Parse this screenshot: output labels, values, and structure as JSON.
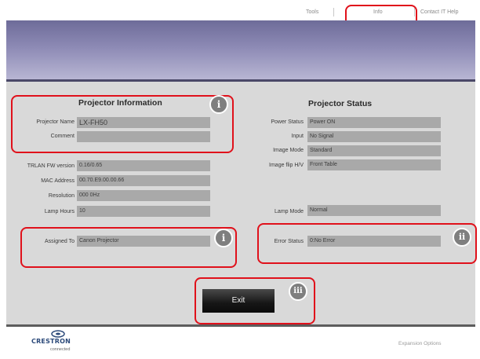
{
  "nav": {
    "tools": "Tools",
    "info": "Info",
    "contact": "Contact IT Help"
  },
  "projector_info": {
    "heading": "Projector Information",
    "name_label": "Projector Name",
    "name_value": "LX-FH50",
    "comment_label": "Comment",
    "comment_value": "",
    "fw_label": "TRLAN FW version",
    "fw_value": "0.16/0.65",
    "mac_label": "MAC Address",
    "mac_value": "00.70.E9.00.00.66",
    "resolution_label": "Resolution",
    "resolution_value": "000 0Hz",
    "lamp_hours_label": "Lamp Hours",
    "lamp_hours_value": "10",
    "assigned_label": "Assigned To",
    "assigned_value": "Canon Projector"
  },
  "projector_status": {
    "heading": "Projector Status",
    "power_label": "Power Status",
    "power_value": "Power ON",
    "input_label": "Input",
    "input_value": "No Signal",
    "image_mode_label": "Image Mode",
    "image_mode_value": "Standard",
    "image_flip_label": "Image flip H/V",
    "image_flip_value": "Front Table",
    "lamp_mode_label": "Lamp Mode",
    "lamp_mode_value": "Normal",
    "error_label": "Error Status",
    "error_value": "0:No Error"
  },
  "badges": {
    "info_1": "i",
    "info_2": "i",
    "error": "ii",
    "exit": "iii"
  },
  "exit_label": "Exit",
  "footer": {
    "logo_text": "CRESTRON",
    "logo_sub": "connected",
    "right_link": "Expansion Options"
  },
  "colors": {
    "annotation": "#e0111b",
    "banner": "#8d8ab5",
    "panel": "#d9d9d9",
    "field": "#a9a9a9"
  }
}
